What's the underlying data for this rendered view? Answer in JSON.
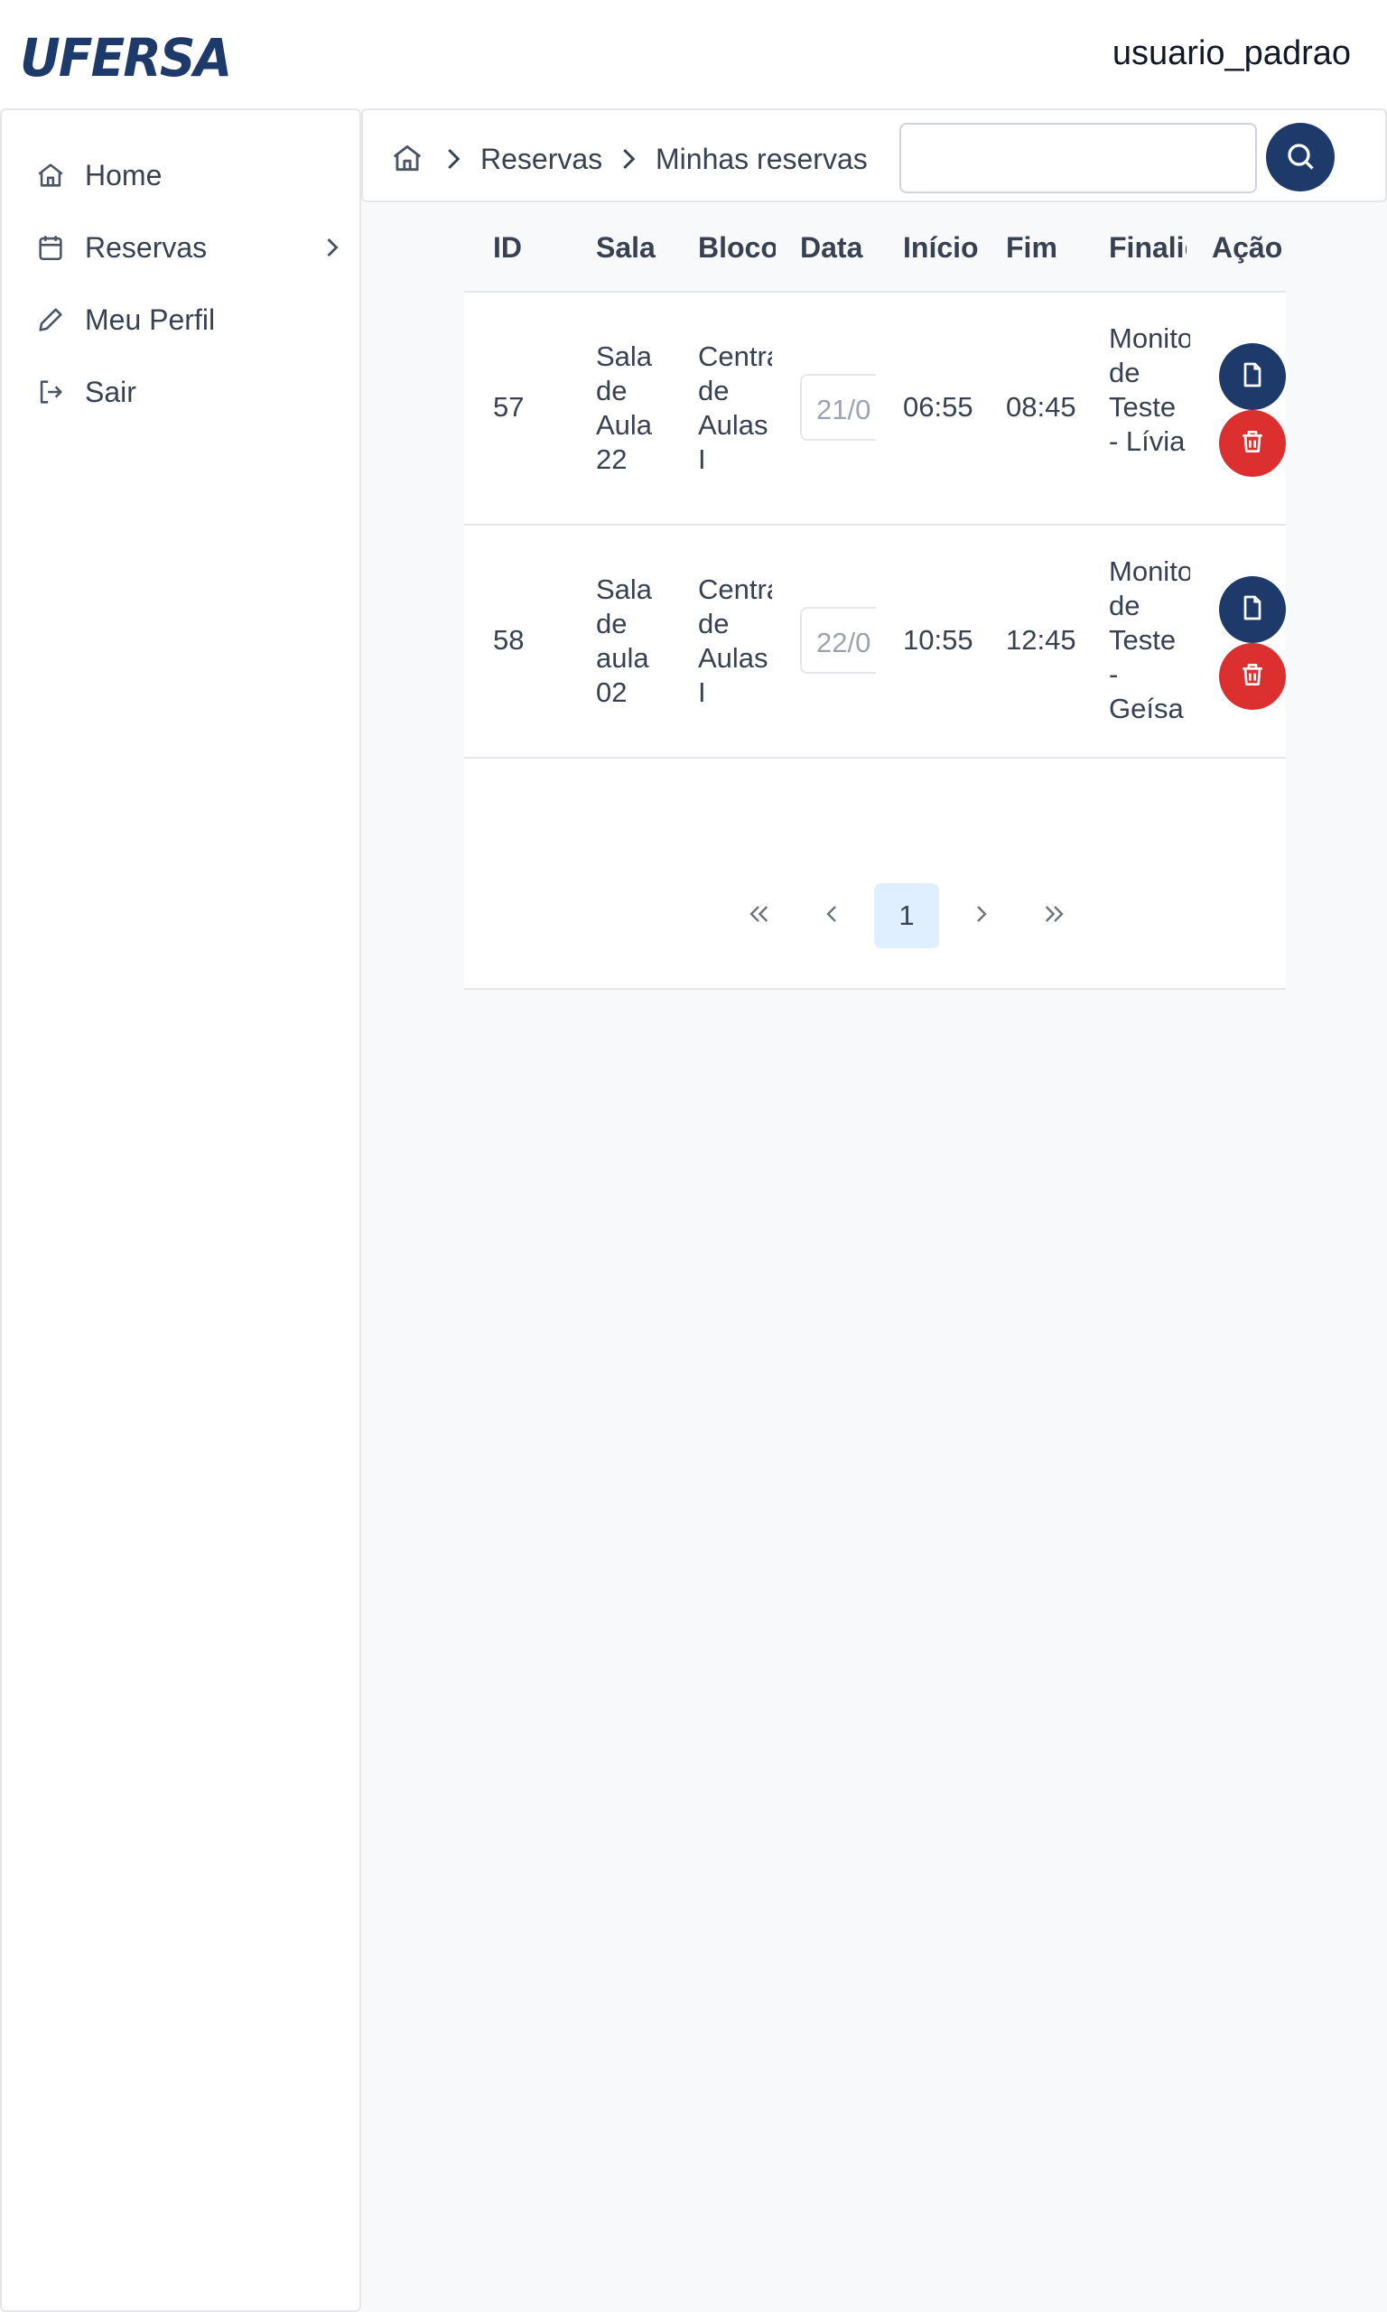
{
  "header": {
    "logo_text": "UFERSA",
    "username": "usuario_padrao",
    "brand_color": "#1e3a6b"
  },
  "sidebar": {
    "items": [
      {
        "label": "Home",
        "icon": "home-icon"
      },
      {
        "label": "Reservas",
        "icon": "calendar-icon",
        "has_submenu": true
      },
      {
        "label": "Meu Perfil",
        "icon": "pencil-icon"
      },
      {
        "label": "Sair",
        "icon": "logout-icon"
      }
    ]
  },
  "breadcrumb": {
    "items": [
      "Reservas",
      "Minhas reservas"
    ]
  },
  "search": {
    "placeholder": "",
    "value": ""
  },
  "table": {
    "headers": [
      "ID",
      "Sala",
      "Bloco",
      "Data",
      "Início",
      "Fim",
      "Finalidade",
      "Ação"
    ],
    "rows": [
      {
        "id": "57",
        "sala": "Sala de Aula 22",
        "bloco": "Central de Aulas I",
        "data": "21/0",
        "inicio": "06:55",
        "fim": "08:45",
        "finalidade": "Monitoria de Teste - Lívia"
      },
      {
        "id": "58",
        "sala": "Sala de aula 02",
        "bloco": "Central de Aulas I",
        "data": "22/0",
        "inicio": "10:55",
        "fim": "12:45",
        "finalidade": "Monitoria de Teste - Geísa"
      }
    ]
  },
  "pagination": {
    "current_page": "1"
  },
  "colors": {
    "delete": "#dc2f2f",
    "primary": "#1e3a6b",
    "page_active_bg": "#e0efff"
  }
}
